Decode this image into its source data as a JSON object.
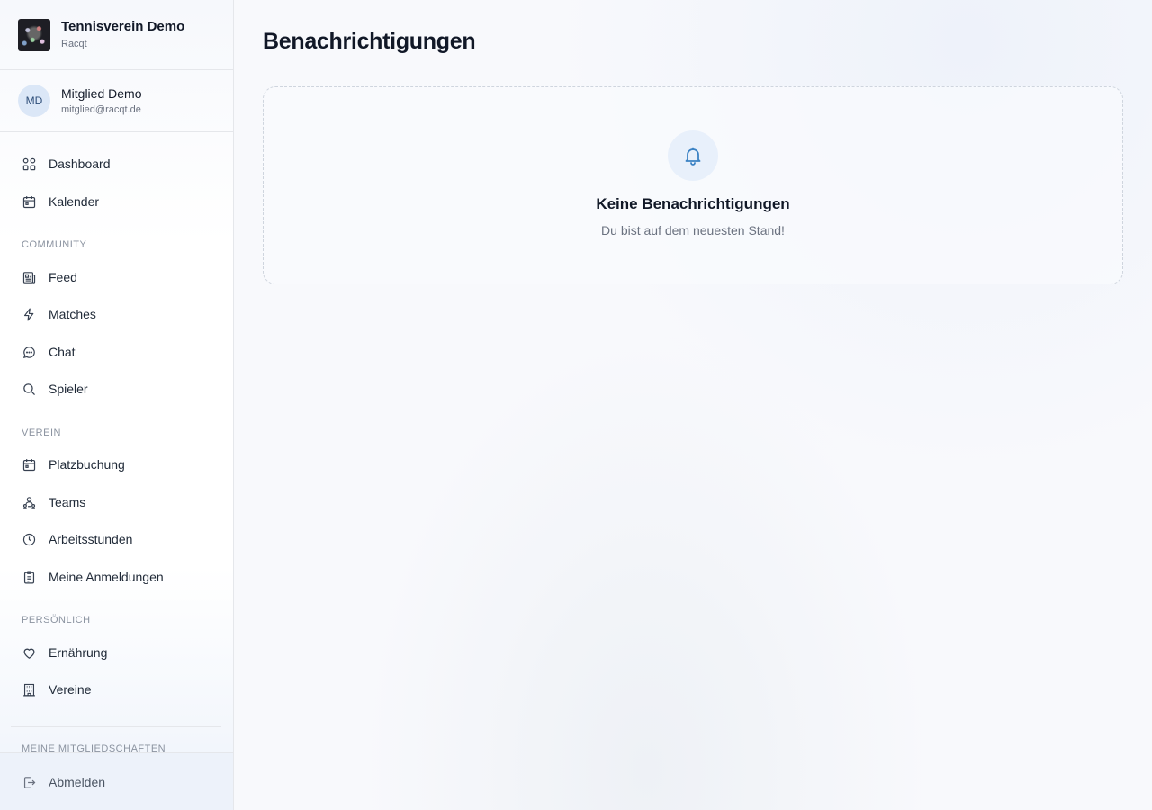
{
  "club": {
    "name": "Tennisverein Demo",
    "subtitle": "Racqt"
  },
  "user": {
    "initials": "MD",
    "name": "Mitglied Demo",
    "email": "mitglied@racqt.de"
  },
  "nav": {
    "top": [
      {
        "label": "Dashboard",
        "icon": "grid-icon"
      },
      {
        "label": "Kalender",
        "icon": "calendar-icon"
      }
    ],
    "community_heading": "COMMUNITY",
    "community": [
      {
        "label": "Feed",
        "icon": "newspaper-icon"
      },
      {
        "label": "Matches",
        "icon": "lightning-icon"
      },
      {
        "label": "Chat",
        "icon": "chat-bubble-icon"
      },
      {
        "label": "Spieler",
        "icon": "search-icon"
      }
    ],
    "verein_heading": "VEREIN",
    "verein": [
      {
        "label": "Platzbuchung",
        "icon": "calendar-icon"
      },
      {
        "label": "Teams",
        "icon": "team-icon"
      },
      {
        "label": "Arbeitsstunden",
        "icon": "clock-icon"
      },
      {
        "label": "Meine Anmeldungen",
        "icon": "clipboard-icon"
      }
    ],
    "persoenlich_heading": "PERSÖNLICH",
    "persoenlich": [
      {
        "label": "Ernährung",
        "icon": "heart-icon"
      },
      {
        "label": "Vereine",
        "icon": "building-icon"
      }
    ],
    "memberships_heading": "MEINE MITGLIEDSCHAFTEN",
    "logout": {
      "label": "Abmelden",
      "icon": "logout-icon"
    }
  },
  "page": {
    "title": "Benachrichtigungen",
    "empty_title": "Keine Benachrichtigungen",
    "empty_subtitle": "Du bist auf dem neuesten Stand!",
    "empty_icon": "bell-icon"
  },
  "colors": {
    "accent": "#3b82c4",
    "border": "#e5e7eb"
  }
}
